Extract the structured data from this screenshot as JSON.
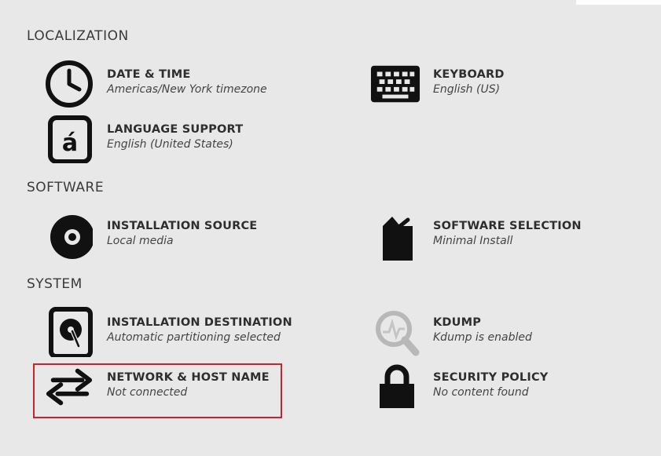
{
  "sections": {
    "localization": "LOCALIZATION",
    "software": "SOFTWARE",
    "system": "SYSTEM"
  },
  "spokes": {
    "date_time": {
      "name": "DATE & TIME",
      "status": "Americas/New York timezone",
      "icon": "clock-icon"
    },
    "keyboard": {
      "name": "KEYBOARD",
      "status": "English (US)",
      "icon": "keyboard-icon"
    },
    "language_support": {
      "name": "LANGUAGE SUPPORT",
      "status": "English (United States)",
      "icon": "language-icon"
    },
    "installation_source": {
      "name": "INSTALLATION SOURCE",
      "status": "Local media",
      "icon": "disc-icon"
    },
    "software_selection": {
      "name": "SOFTWARE SELECTION",
      "status": "Minimal Install",
      "icon": "package-icon"
    },
    "installation_destination": {
      "name": "INSTALLATION DESTINATION",
      "status": "Automatic partitioning selected",
      "icon": "harddisk-icon"
    },
    "kdump": {
      "name": "KDUMP",
      "status": "Kdump is enabled",
      "icon": "kdump-magnifier-icon"
    },
    "network_hostname": {
      "name": "NETWORK & HOST NAME",
      "status": "Not connected",
      "icon": "network-arrows-icon"
    },
    "security_policy": {
      "name": "SECURITY POLICY",
      "status": "No content found",
      "icon": "lock-icon"
    }
  },
  "highlight_color": "#d0202c"
}
